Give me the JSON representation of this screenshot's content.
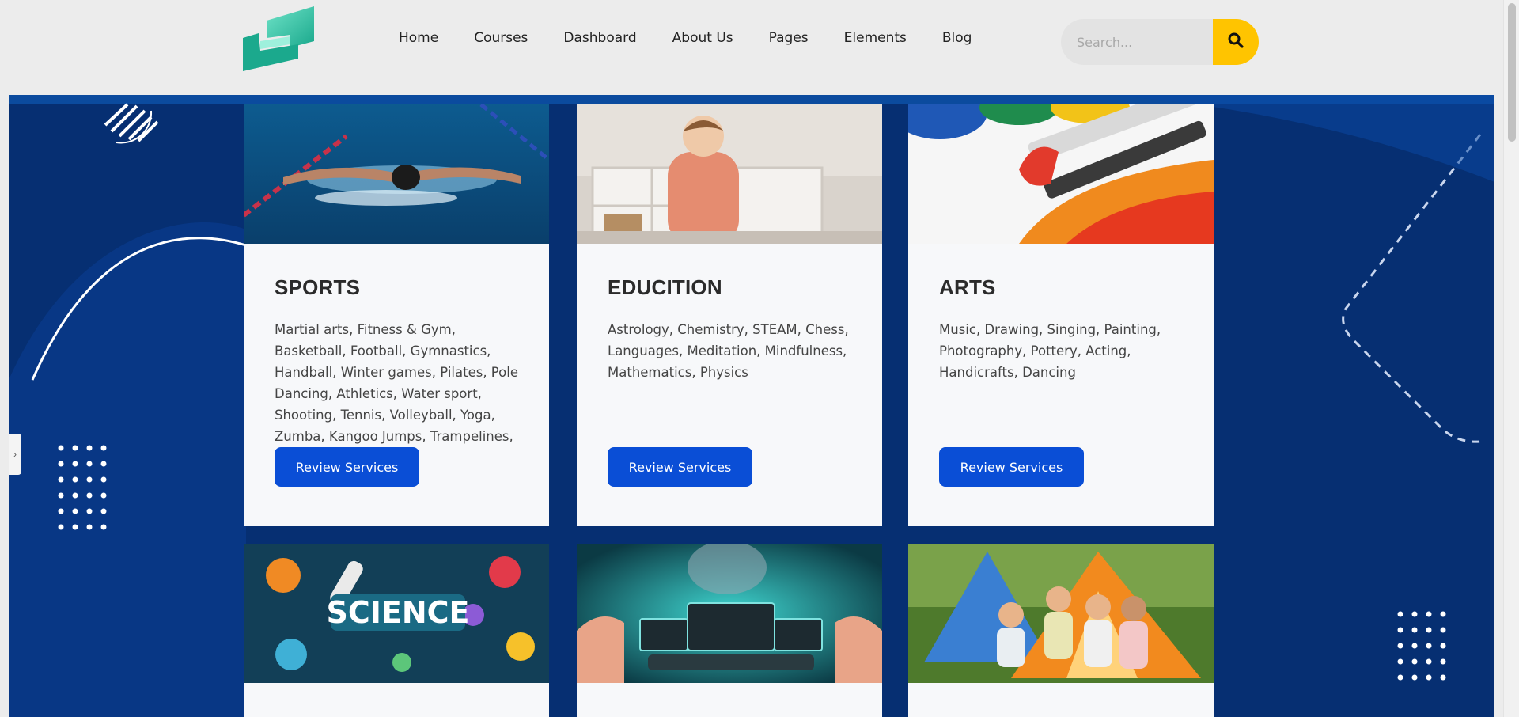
{
  "header": {
    "nav": [
      "Home",
      "Courses",
      "Dashboard",
      "About Us",
      "Pages",
      "Elements",
      "Blog"
    ],
    "search_placeholder": "Search..."
  },
  "colors": {
    "accent": "#ffc400",
    "primary_button": "#0a4ed6",
    "hero_bg": "#062f72",
    "logo": "#2ec4a8"
  },
  "cards": [
    {
      "title": "SPORTS",
      "image": "swimmer-photo",
      "text": "Martial arts, Fitness & Gym, Basketball, Football, Gymnastics, Handball, Winter games, Pilates, Pole Dancing, Athletics, Water sport, Shooting, Tennis, Volleyball, Yoga, Zumba, Kangoo Jumps, Trampelines, Climbing walls",
      "button": "Review Services"
    },
    {
      "title": "EDUCITION",
      "image": "child-playing-photo",
      "text": "Astrology, Chemistry, STEAM, Chess, Languages, Meditation, Mindfulness, Mathematics, Physics",
      "button": "Review Services"
    },
    {
      "title": "ARTS",
      "image": "paint-brushes-photo",
      "text": "Music, Drawing, Singing, Painting, Photography, Pottery, Acting, Handicrafts, Dancing",
      "button": "Review Services"
    }
  ],
  "bottom_cards": [
    {
      "image": "science-doodle-image",
      "label": "SCIENCE"
    },
    {
      "image": "technology-hands-photo"
    },
    {
      "image": "kids-camping-tent-photo"
    }
  ]
}
